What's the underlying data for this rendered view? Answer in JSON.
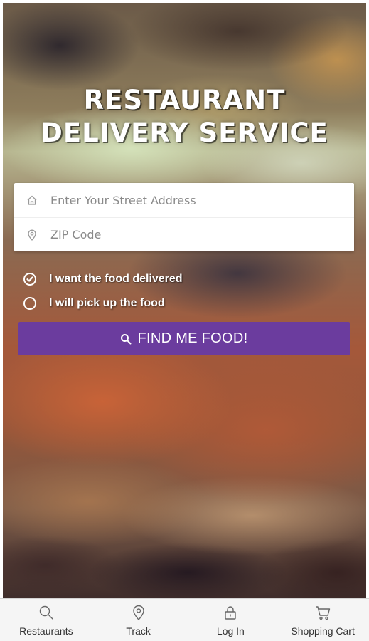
{
  "hero": {
    "title_line1": "RESTAURANT",
    "title_line2": "DELIVERY SERVICE"
  },
  "form": {
    "address": {
      "placeholder": "Enter Your Street Address",
      "value": "",
      "icon": "home-icon"
    },
    "zip": {
      "placeholder": "ZIP Code",
      "value": "",
      "icon": "location-pin-icon"
    }
  },
  "options": [
    {
      "label": "I want the food delivered",
      "selected": true
    },
    {
      "label": "I will pick up the food",
      "selected": false
    }
  ],
  "find_button": {
    "label": "FIND ME FOOD!",
    "icon": "search-icon"
  },
  "tabbar": {
    "items": [
      {
        "label": "Restaurants",
        "icon": "search-icon"
      },
      {
        "label": "Track",
        "icon": "location-pin-icon"
      },
      {
        "label": "Log In",
        "icon": "lock-icon"
      },
      {
        "label": "Shopping Cart",
        "icon": "cart-icon"
      }
    ]
  },
  "colors": {
    "accent": "#6b3c9e",
    "tabbar_bg": "#f5f5f5",
    "text_dark": "#333333"
  }
}
